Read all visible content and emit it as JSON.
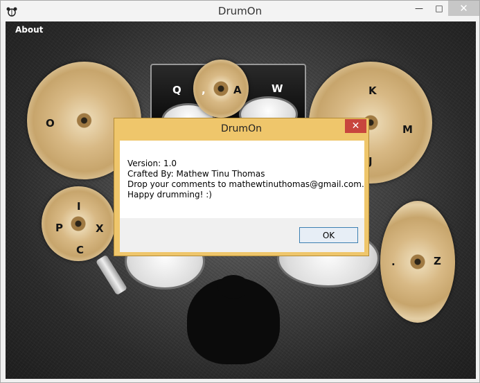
{
  "window": {
    "title": "DrumOn",
    "icon": "drum-kit-icon"
  },
  "menu": {
    "about": "About"
  },
  "keys": {
    "left_cymbal": "O",
    "hihat_top": "I",
    "hihat_left": "P",
    "hihat_right": "X",
    "hihat_bottom": "C",
    "tom_left": "Q",
    "center_cymbal_left": ",",
    "center_cymbal_right": "A",
    "tom_right": "W",
    "right_cymbal_top": "K",
    "right_cymbal_right": "M",
    "right_cymbal_bottom": "J",
    "china_dot": ".",
    "china_right": "Z"
  },
  "dialog": {
    "title": "DrumOn",
    "lines": [
      "Version: 1.0",
      "Crafted By: Mathew Tinu Thomas",
      "Drop your comments to mathewtinuthomas@gmail.com.",
      "Happy drumming! :)"
    ],
    "ok": "OK"
  }
}
